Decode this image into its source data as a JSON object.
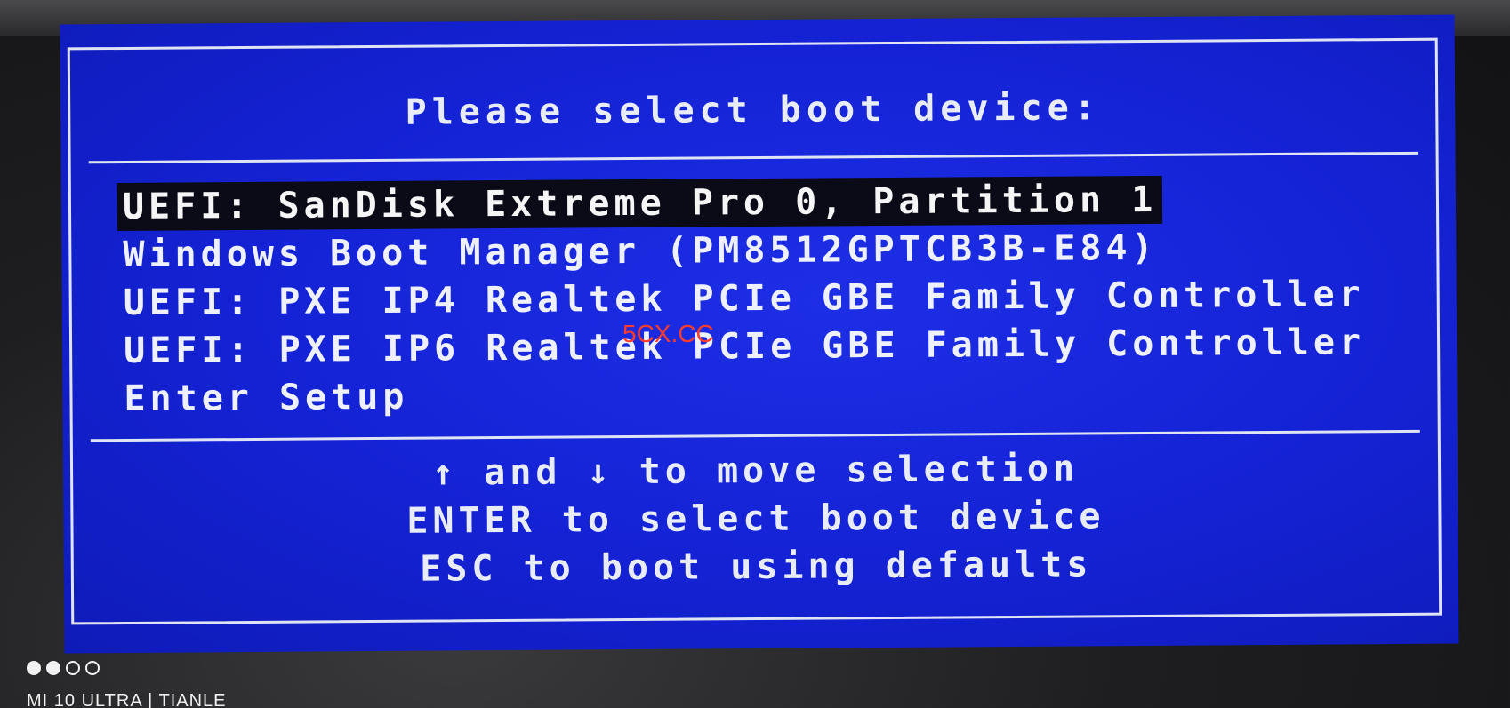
{
  "bios": {
    "title": "Please select boot device:",
    "devices": [
      {
        "label": "UEFI: SanDisk Extreme Pro 0, Partition 1",
        "selected": true
      },
      {
        "label": "Windows Boot Manager (PM8512GPTCB3B-E84)",
        "selected": false
      },
      {
        "label": "UEFI: PXE IP4 Realtek PCIe GBE Family Controller",
        "selected": false
      },
      {
        "label": "UEFI: PXE IP6 Realtek PCIe GBE Family Controller",
        "selected": false
      },
      {
        "label": "Enter Setup",
        "selected": false
      }
    ],
    "help": {
      "line1_up_arrow": "↑",
      "line1_and": "and",
      "line1_down_arrow": "↓",
      "line1_rest": "to move selection",
      "line2": "ENTER to select boot device",
      "line3": "ESC to boot using defaults"
    },
    "colors": {
      "background": "#1422d4",
      "text": "#eef1fb",
      "selected_bg": "#0b0b18"
    }
  },
  "watermark": "5CX.CC",
  "photo": {
    "camera_label": "MI 10 ULTRA | TIANLE"
  }
}
